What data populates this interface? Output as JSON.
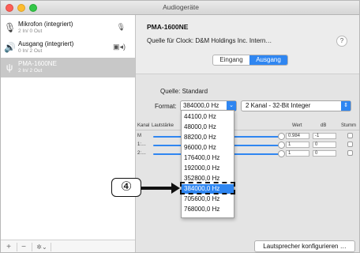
{
  "window": {
    "title": "Audiogeräte"
  },
  "sidebar": {
    "devices": [
      {
        "name": "Mikrofon (integriert)",
        "sub": "2 In/ 0 Out",
        "icon": "microphone-icon",
        "right_icon": "microphone-small-icon"
      },
      {
        "name": "Ausgang (integriert)",
        "sub": "0 In/ 2 Out",
        "icon": "speaker-icon",
        "right_icon": "speaker-volume-icon"
      },
      {
        "name": "PMA-1600NE",
        "sub": "2 In/ 2 Out",
        "icon": "usb-icon",
        "selected": true
      }
    ],
    "bottom": {
      "add": "+",
      "remove": "−",
      "gear": "✲⌄"
    }
  },
  "main": {
    "device_title": "PMA-1600NE",
    "clock_label": "Quelle für Clock:  D&M Holdings Inc. Intern…",
    "help": "?",
    "tabs": [
      {
        "label": "Eingang"
      },
      {
        "label": "Ausgang",
        "active": true
      }
    ],
    "source_label": "Quelle:  Standard",
    "format_label": "Format:",
    "format_value": "384000,0 Hz",
    "channel_value": "2 Kanal - 32-Bit Integer",
    "table": {
      "headers": {
        "channel": "Kanal",
        "volume": "Lautstärke",
        "value": "Wert",
        "db": "dB",
        "mute": "Stumm"
      },
      "rows": [
        {
          "name": "M",
          "value": "0.984",
          "db": "-1"
        },
        {
          "name": "1:…",
          "value": "1",
          "db": "0"
        },
        {
          "name": "2:…",
          "value": "1",
          "db": "0"
        }
      ]
    },
    "speaker_button": "Lautsprecher konfigurieren …"
  },
  "dropdown": {
    "options": [
      "44100,0 Hz",
      "48000,0 Hz",
      "88200,0 Hz",
      "96000,0 Hz",
      "176400,0 Hz",
      "192000,0 Hz",
      "352800,0 Hz",
      "384000,0 Hz",
      "705600,0 Hz",
      "768000,0 Hz"
    ],
    "selected_index": 7
  },
  "callout": {
    "number": "④"
  },
  "colors": {
    "accent": "#2f86f1",
    "sidebar_selected": "#c8c8c8"
  }
}
